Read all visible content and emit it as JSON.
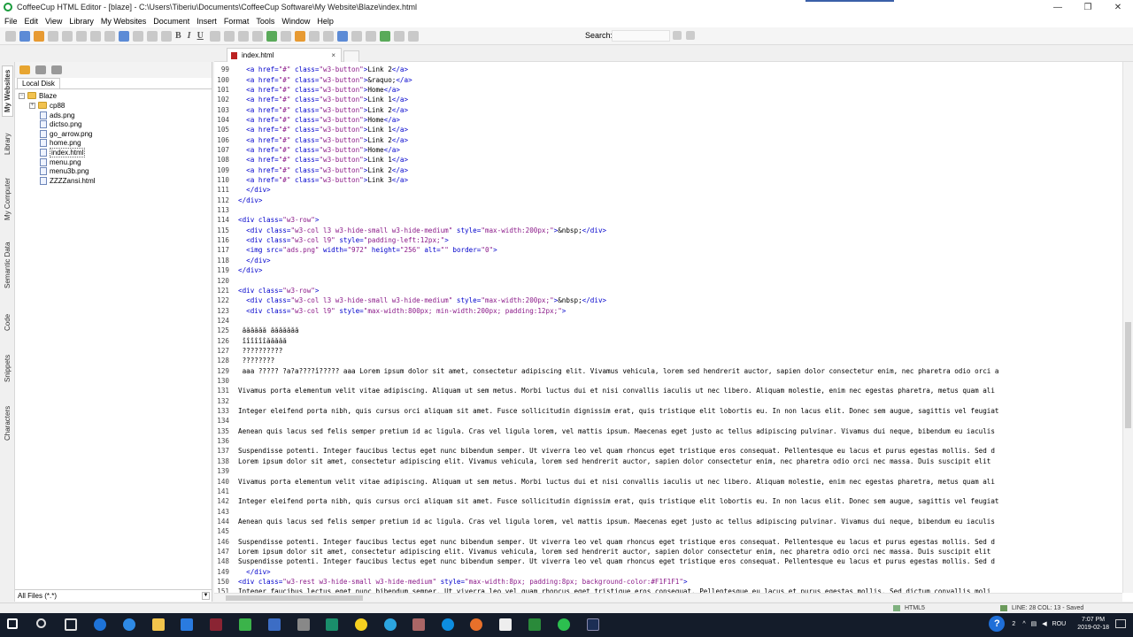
{
  "window": {
    "title": "CoffeeCup HTML Editor - [blaze] - C:\\Users\\Tiberiu\\Documents\\CoffeeCup Software\\My Website\\Blaze\\index.html",
    "minimize_label": "—",
    "restore_label": "❐",
    "close_label": "✕"
  },
  "menu": [
    "File",
    "Edit",
    "View",
    "Library",
    "My Websites",
    "Document",
    "Insert",
    "Format",
    "Tools",
    "Window",
    "Help"
  ],
  "toolbar": {
    "search_label": "Search:",
    "search_value": "",
    "bold": "B",
    "italic": "I",
    "underline": "U"
  },
  "sidetabs": [
    "My Websites",
    "Library",
    "My Computer",
    "Semantic Data",
    "Code",
    "Snippets",
    "Characters"
  ],
  "file_panel": {
    "tab": "Local Disk",
    "root": "Blaze",
    "folder": "cp88",
    "files": [
      "ads.png",
      "dictso.png",
      "go_arrow.png",
      "home.png",
      "index.html",
      "menu.png",
      "menu3b.png",
      "ZZZZansi.html"
    ],
    "selected": "index.html",
    "filter": "All Files (*.*)"
  },
  "editor": {
    "tab_label": "index.html",
    "tab_close": "×",
    "lines": [
      {
        "n": "99",
        "t": "  <a href=\"#\" class=\"w3-button\">Link 2</a>"
      },
      {
        "n": "100",
        "t": "  <a href=\"#\" class=\"w3-button\">&raquo;</a>"
      },
      {
        "n": "101",
        "t": "  <a href=\"#\" class=\"w3-button\">Home</a>"
      },
      {
        "n": "102",
        "t": "  <a href=\"#\" class=\"w3-button\">Link 1</a>"
      },
      {
        "n": "103",
        "t": "  <a href=\"#\" class=\"w3-button\">Link 2</a>"
      },
      {
        "n": "104",
        "t": "  <a href=\"#\" class=\"w3-button\">Home</a>"
      },
      {
        "n": "105",
        "t": "  <a href=\"#\" class=\"w3-button\">Link 1</a>"
      },
      {
        "n": "106",
        "t": "  <a href=\"#\" class=\"w3-button\">Link 2</a>"
      },
      {
        "n": "107",
        "t": "  <a href=\"#\" class=\"w3-button\">Home</a>"
      },
      {
        "n": "108",
        "t": "  <a href=\"#\" class=\"w3-button\">Link 1</a>"
      },
      {
        "n": "109",
        "t": "  <a href=\"#\" class=\"w3-button\">Link 2</a>"
      },
      {
        "n": "110",
        "t": "  <a href=\"#\" class=\"w3-button\">Link 3</a>"
      },
      {
        "n": "111",
        "t": "  </div>"
      },
      {
        "n": "112",
        "t": "</div>"
      },
      {
        "n": "113",
        "t": ""
      },
      {
        "n": "114",
        "t": "<div class=\"w3-row\">"
      },
      {
        "n": "115",
        "t": "  <div class=\"w3-col l3 w3-hide-small w3-hide-medium\" style=\"max-width:200px;\">&nbsp;</div>"
      },
      {
        "n": "116",
        "t": "  <div class=\"w3-col l9\" style=\"padding-left:12px;\">"
      },
      {
        "n": "117",
        "t": "  <img src=\"ads.png\" width=\"972\" height=\"256\" alt=\"\" border=\"0\">"
      },
      {
        "n": "118",
        "t": "  </div>"
      },
      {
        "n": "119",
        "t": "</div>"
      },
      {
        "n": "120",
        "t": ""
      },
      {
        "n": "121",
        "t": "<div class=\"w3-row\">"
      },
      {
        "n": "122",
        "t": "  <div class=\"w3-col l3 w3-hide-small w3-hide-medium\" style=\"max-width:200px;\">&nbsp;</div>"
      },
      {
        "n": "123",
        "t": "  <div class=\"w3-col l9\" style=\"max-width:800px; min-width:200px; padding:12px;\">"
      },
      {
        "n": "124",
        "t": ""
      },
      {
        "n": "125",
        "t": " ăăăăăă ăăăăăăă"
      },
      {
        "n": "126",
        "t": " îîîîîîăăăăă"
      },
      {
        "n": "127",
        "t": " ??????????"
      },
      {
        "n": "128",
        "t": " ????????"
      },
      {
        "n": "129",
        "t": " aaa ????? ?a?a????î????? aaa Lorem ipsum dolor sit amet, consectetur adipiscing elit. Vivamus vehicula, lorem sed hendrerit auctor, sapien dolor consectetur enim, nec pharetra odio orci a"
      },
      {
        "n": "130",
        "t": ""
      },
      {
        "n": "131",
        "t": "Vivamus porta elementum velit vitae adipiscing. Aliquam ut sem metus. Morbi luctus dui et nisi convallis iaculis ut nec libero. Aliquam molestie, enim nec egestas pharetra, metus quam ali"
      },
      {
        "n": "132",
        "t": ""
      },
      {
        "n": "133",
        "t": "Integer eleifend porta nibh, quis cursus orci aliquam sit amet. Fusce sollicitudin dignissim erat, quis tristique elit lobortis eu. In non lacus elit. Donec sem augue, sagittis vel feugiat"
      },
      {
        "n": "134",
        "t": ""
      },
      {
        "n": "135",
        "t": "Aenean quis lacus sed felis semper pretium id ac ligula. Cras vel ligula lorem, vel mattis ipsum. Maecenas eget justo ac tellus adipiscing pulvinar. Vivamus dui neque, bibendum eu iaculis"
      },
      {
        "n": "136",
        "t": ""
      },
      {
        "n": "137",
        "t": "Suspendisse potenti. Integer faucibus lectus eget nunc bibendum semper. Ut viverra leo vel quam rhoncus eget tristique eros consequat. Pellentesque eu lacus et purus egestas mollis. Sed d"
      },
      {
        "n": "138",
        "t": "Lorem ipsum dolor sit amet, consectetur adipiscing elit. Vivamus vehicula, lorem sed hendrerit auctor, sapien dolor consectetur enim, nec pharetra odio orci nec massa. Duis suscipit elit"
      },
      {
        "n": "139",
        "t": ""
      },
      {
        "n": "140",
        "t": "Vivamus porta elementum velit vitae adipiscing. Aliquam ut sem metus. Morbi luctus dui et nisi convallis iaculis ut nec libero. Aliquam molestie, enim nec egestas pharetra, metus quam ali"
      },
      {
        "n": "141",
        "t": ""
      },
      {
        "n": "142",
        "t": "Integer eleifend porta nibh, quis cursus orci aliquam sit amet. Fusce sollicitudin dignissim erat, quis tristique elit lobortis eu. In non lacus elit. Donec sem augue, sagittis vel feugiat"
      },
      {
        "n": "143",
        "t": ""
      },
      {
        "n": "144",
        "t": "Aenean quis lacus sed felis semper pretium id ac ligula. Cras vel ligula lorem, vel mattis ipsum. Maecenas eget justo ac tellus adipiscing pulvinar. Vivamus dui neque, bibendum eu iaculis"
      },
      {
        "n": "145",
        "t": ""
      },
      {
        "n": "146",
        "t": "Suspendisse potenti. Integer faucibus lectus eget nunc bibendum semper. Ut viverra leo vel quam rhoncus eget tristique eros consequat. Pellentesque eu lacus et purus egestas mollis. Sed d"
      },
      {
        "n": "147",
        "t": "Lorem ipsum dolor sit amet, consectetur adipiscing elit. Vivamus vehicula, lorem sed hendrerit auctor, sapien dolor consectetur enim, nec pharetra odio orci nec massa. Duis suscipit elit"
      },
      {
        "n": "148",
        "t": "Suspendisse potenti. Integer faucibus lectus eget nunc bibendum semper. Ut viverra leo vel quam rhoncus eget tristique eros consequat. Pellentesque eu lacus et purus egestas mollis. Sed d"
      },
      {
        "n": "149",
        "t": "  </div>"
      },
      {
        "n": "150",
        "t": "<div class=\"w3-rest w3-hide-small w3-hide-medium\" style=\"max-width:8px; padding:8px; background-color:#F1F1F1\">"
      },
      {
        "n": "151",
        "t": "Integer faucibus lectus eget nunc bibendum semper. Ut viverra leo vel quam rhoncus eget tristique eros consequat. Pellentesque eu lacus et purus egestas mollis. Sed dictum convallis moli"
      }
    ]
  },
  "status": {
    "mode": "HTML5",
    "position": "LINE: 28 COL: 13 - Saved"
  },
  "taskbar": {
    "lang": "ROU",
    "time": "7:07 PM",
    "date": "2019-02-18",
    "notification_count": "2"
  },
  "colors": {
    "tag": "#0000cc",
    "attr_value": "#8b1a89",
    "taskbar": "#141c2a"
  }
}
